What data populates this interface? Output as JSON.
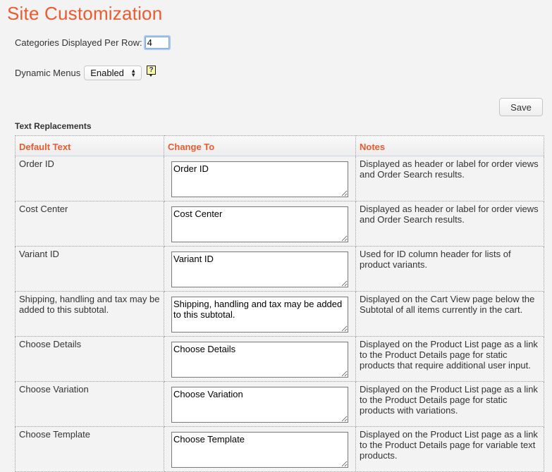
{
  "page": {
    "title": "Site Customization"
  },
  "settings": {
    "categories_label": "Categories Displayed Per Row:",
    "categories_value": "4",
    "menus_label": "Dynamic Menus",
    "menus_selected": "Enabled",
    "help_icon_glyph": "?"
  },
  "toolbar": {
    "save_label": "Save"
  },
  "text_replacements": {
    "heading": "Text Replacements",
    "columns": [
      "Default Text",
      "Change To",
      "Notes"
    ],
    "rows": [
      {
        "default": "Order ID",
        "change_to": "Order ID",
        "notes": "Displayed as header or label for order views and Order Search results."
      },
      {
        "default": "Cost Center",
        "change_to": "Cost Center",
        "notes": "Displayed as header or label for order views and Order Search results."
      },
      {
        "default": "Variant ID",
        "change_to": "Variant ID",
        "notes": "Used for ID column header for lists of product variants."
      },
      {
        "default": "Shipping, handling and tax may be added to this subtotal.",
        "change_to": "Shipping, handling and tax may be added to this subtotal.",
        "notes": "Displayed on the Cart View page below the Subtotal of all items currently in the cart."
      },
      {
        "default": "Choose Details",
        "change_to": "Choose Details",
        "notes": "Displayed on the Product List page as a link to the Product Details page for static products that require additional user input."
      },
      {
        "default": "Choose Variation",
        "change_to": "Choose Variation",
        "notes": "Displayed on the Product List page as a link to the Product Details page for static products with variations."
      },
      {
        "default": "Choose Template",
        "change_to": "Choose Template",
        "notes": "Displayed on the Product List page as a link to the Product Details page for variable text products."
      }
    ]
  },
  "colors": {
    "accent": "#ee5a2e",
    "background": "#f3f3f3",
    "focus_ring": "#a9c8f0"
  }
}
